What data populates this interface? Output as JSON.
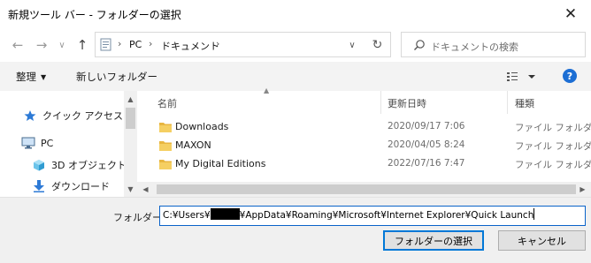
{
  "window": {
    "title": "新規ツール バー - フォルダーの選択",
    "close_glyph": "✕"
  },
  "nav": {
    "back_glyph": "←",
    "forward_glyph": "→",
    "recent_glyph": "∨",
    "up_glyph": "↑",
    "breadcrumb": [
      "PC",
      "ドキュメント"
    ],
    "separator_glyph": "›",
    "refresh_glyph": "↻",
    "search_placeholder": "ドキュメントの検索"
  },
  "toolbar": {
    "organize_label": "整理",
    "new_folder_label": "新しいフォルダー",
    "help_label": "?"
  },
  "sidebar": {
    "items": [
      {
        "label": "クイック アクセス",
        "icon": "star-icon"
      },
      {
        "label": "PC",
        "icon": "computer-icon"
      },
      {
        "label": "3D オブジェクト",
        "icon": "cube-icon"
      },
      {
        "label": "ダウンロード",
        "icon": "download-arrow-icon"
      }
    ]
  },
  "list": {
    "columns": {
      "name": "名前",
      "date": "更新日時",
      "type": "種類"
    },
    "rows": [
      {
        "name": "Downloads",
        "date": "2020/09/17 7:06",
        "type": "ファイル フォルダー"
      },
      {
        "name": "MAXON",
        "date": "2020/04/05 8:24",
        "type": "ファイル フォルダー"
      },
      {
        "name": "My Digital Editions",
        "date": "2022/07/16 7:47",
        "type": "ファイル フォルダー"
      }
    ]
  },
  "footer": {
    "folder_label": "フォルダー:",
    "folder_path_start": "C:¥Users¥",
    "folder_path_end": "¥AppData¥Roaming¥Microsoft¥Internet Explorer¥Quick Launch",
    "select_button": "フォルダーの選択",
    "cancel_button": "キャンセル"
  },
  "colors": {
    "accent": "#0078d7",
    "folder": "#e8b640",
    "help_icon": "#1c6ed4"
  }
}
